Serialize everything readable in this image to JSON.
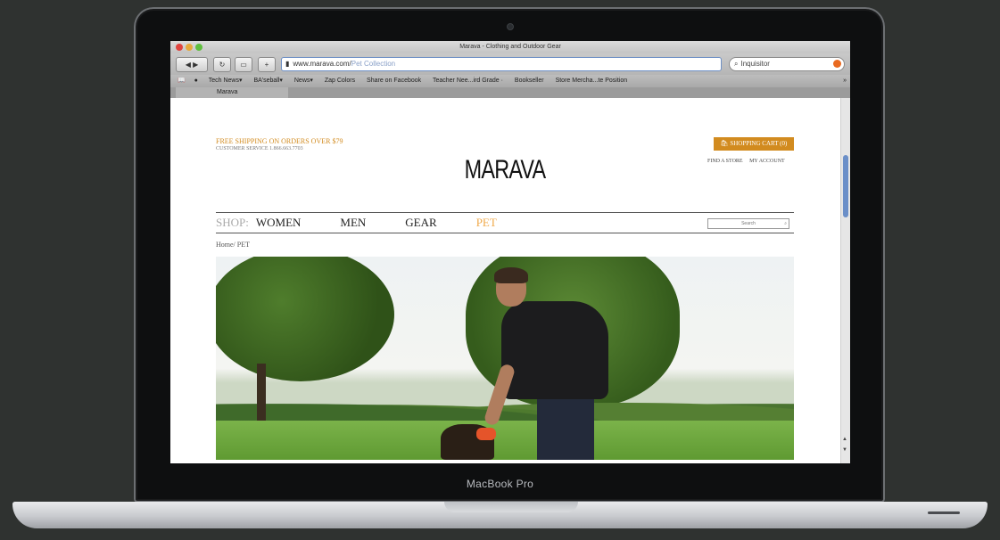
{
  "device": {
    "label": "MacBook Pro"
  },
  "browser": {
    "window_title": "Marava - Clothing and Outdoor Gear",
    "url_domain": "www.marava.com/",
    "url_path": "Pet Collection",
    "search_value": "Inquisitor",
    "bookmarks": [
      "Tech News▾",
      "BA'seball▾",
      "News▾",
      "Zap Colors",
      "Share on Facebook",
      "Teacher Nee...ird Grade ·",
      "Bookseller",
      "Store Mercha...te Position"
    ],
    "tab_label": "Marava",
    "overflow_glyph": "»"
  },
  "store": {
    "shipping_text": "FREE SHIPPING ON ORDERS OVER $79",
    "customer_service": "CUSTOMER SERVICE 1.866.663.7703",
    "cart_label": "SHOPPING CART (0)",
    "find_store": "FIND A STORE",
    "my_account": "MY ACCOUNT",
    "logo": "MARAVA",
    "shop_label": "SHOP:",
    "nav": [
      "WOMEN",
      "MEN",
      "GEAR",
      "PET"
    ],
    "active_nav": "PET",
    "search_placeholder": "Search",
    "breadcrumb": "Home/ PET"
  },
  "colors": {
    "accent": "#d28b1f",
    "active_nav": "#f0a94a",
    "url_focus": "#6d8fc4"
  }
}
